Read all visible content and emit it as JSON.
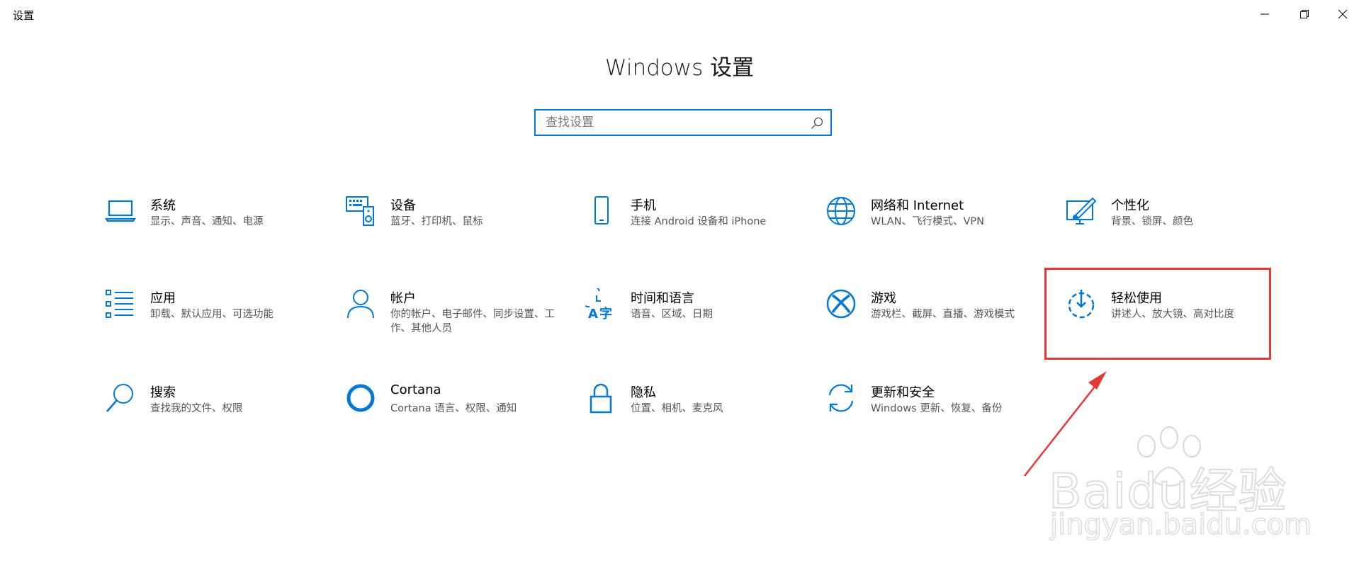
{
  "window": {
    "title": "设置"
  },
  "page": {
    "title": "Windows 设置"
  },
  "search": {
    "placeholder": "查找设置"
  },
  "colors": {
    "accent": "#0078d7",
    "highlight": "#e53935"
  },
  "tiles": [
    {
      "title": "系统",
      "subtitle": "显示、声音、通知、电源",
      "icon": "laptop-icon"
    },
    {
      "title": "设备",
      "subtitle": "蓝牙、打印机、鼠标",
      "icon": "keyboard-speaker-icon"
    },
    {
      "title": "手机",
      "subtitle": "连接 Android 设备和 iPhone",
      "icon": "phone-icon"
    },
    {
      "title": "网络和 Internet",
      "subtitle": "WLAN、飞行模式、VPN",
      "icon": "globe-icon"
    },
    {
      "title": "个性化",
      "subtitle": "背景、锁屏、颜色",
      "icon": "paint-brush-icon"
    },
    {
      "title": "应用",
      "subtitle": "卸载、默认应用、可选功能",
      "icon": "app-list-icon"
    },
    {
      "title": "帐户",
      "subtitle": "你的帐户、电子邮件、同步设置、工作、其他人员",
      "icon": "person-icon"
    },
    {
      "title": "时间和语言",
      "subtitle": "语音、区域、日期",
      "icon": "time-language-icon"
    },
    {
      "title": "游戏",
      "subtitle": "游戏栏、截屏、直播、游戏模式",
      "icon": "xbox-icon"
    },
    {
      "title": "轻松使用",
      "subtitle": "讲述人、放大镜、高对比度",
      "icon": "ease-of-access-icon"
    },
    {
      "title": "搜索",
      "subtitle": "查找我的文件、权限",
      "icon": "magnifier-icon"
    },
    {
      "title": "Cortana",
      "subtitle": "Cortana 语言、权限、通知",
      "icon": "cortana-icon"
    },
    {
      "title": "隐私",
      "subtitle": "位置、相机、麦克风",
      "icon": "lock-icon"
    },
    {
      "title": "更新和安全",
      "subtitle": "Windows 更新、恢复、备份",
      "icon": "sync-icon"
    }
  ],
  "watermark": {
    "main": "Baidu经验",
    "sub": "jingyan.baidu.com"
  }
}
